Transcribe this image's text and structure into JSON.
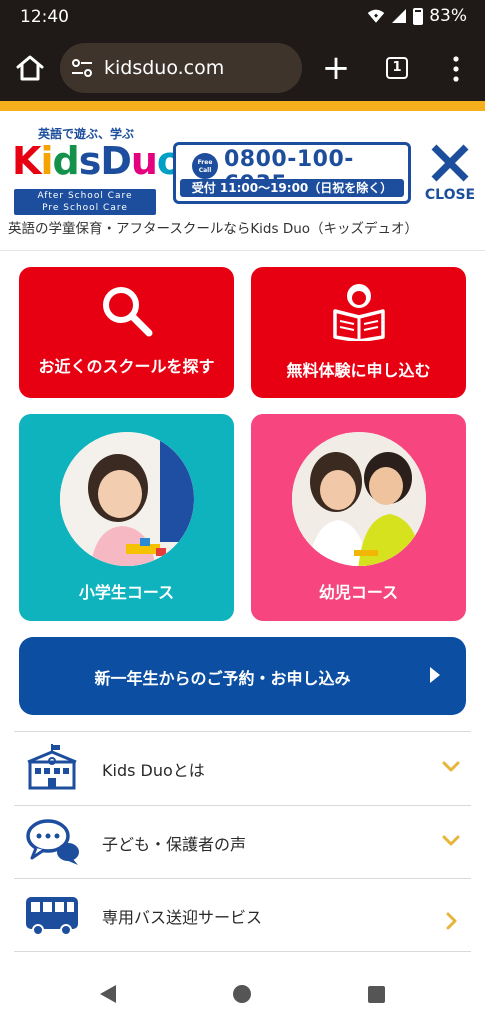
{
  "status_bar": {
    "time": "12:40",
    "battery": "83%"
  },
  "browser": {
    "url": "kidsduo.com",
    "tab_count": "1"
  },
  "header": {
    "logo_tagline": "英語で遊ぶ、学ぶ",
    "logo_sub_1": "After School Care",
    "logo_sub_2": "Pre School Care",
    "free_call_1": "Free",
    "free_call_2": "Call",
    "phone": "0800-100-6935",
    "hours": "受付 11:00〜19:00（日祝を除く）",
    "close_label": "CLOSE",
    "tagline": "英語の学童保育・アフタースクールならKids Duo（キッズデュオ）"
  },
  "tiles": {
    "find_school": "お近くのスクールを探す",
    "free_trial": "無料体験に申し込む",
    "elementary": "小学生コース",
    "preschool": "幼児コース"
  },
  "cta": {
    "label": "新一年生からのご予約・お申し込み"
  },
  "accordion": [
    {
      "label": "Kids Duoとは",
      "icon": "school-building-icon"
    },
    {
      "label": "子ども・保護者の声",
      "icon": "speech-bubbles-icon"
    },
    {
      "label": "専用バス送迎サービス",
      "icon": "bus-icon"
    }
  ],
  "colors": {
    "brand_blue": "#1d4e9d",
    "accent_yellow": "#f6b01e",
    "tile_red": "#e60012",
    "tile_teal": "#0fb3bd",
    "tile_pink": "#f6457f",
    "cta_blue": "#0b4ea2",
    "chevron_yellow": "#e6b53a"
  }
}
